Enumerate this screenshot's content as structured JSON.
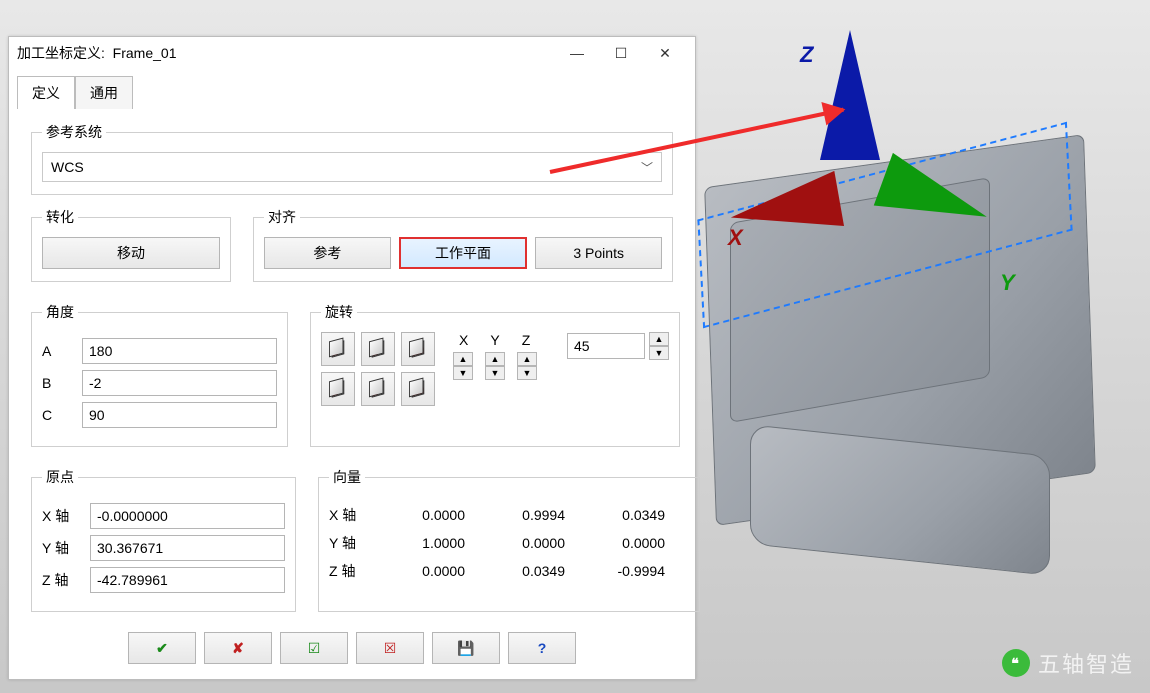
{
  "window": {
    "title_prefix": "加工坐标定义:",
    "title_name": "Frame_01"
  },
  "tabs": {
    "define": "定义",
    "general": "通用"
  },
  "ref_system": {
    "legend": "参考系统",
    "value": "WCS"
  },
  "transform": {
    "legend": "转化",
    "move": "移动"
  },
  "align": {
    "legend": "对齐",
    "ref": "参考",
    "workplane": "工作平面",
    "three_points": "3 Points"
  },
  "angle": {
    "legend": "角度",
    "A": {
      "label": "A",
      "value": "180"
    },
    "B": {
      "label": "B",
      "value": "-2"
    },
    "C": {
      "label": "C",
      "value": "90"
    }
  },
  "rotate": {
    "legend": "旋转",
    "xyz": {
      "x": "X",
      "y": "Y",
      "z": "Z"
    },
    "step": "45"
  },
  "origin": {
    "legend": "原点",
    "X": {
      "label": "X 轴",
      "value": "-0.0000000"
    },
    "Y": {
      "label": "Y 轴",
      "value": "30.367671"
    },
    "Z": {
      "label": "Z 轴",
      "value": "-42.789961"
    }
  },
  "vector": {
    "legend": "向量",
    "rows": [
      {
        "label": "X 轴",
        "v1": "0.0000",
        "v2": "0.9994",
        "v3": "0.0349"
      },
      {
        "label": "Y 轴",
        "v1": "1.0000",
        "v2": "0.0000",
        "v3": "0.0000"
      },
      {
        "label": "Z 轴",
        "v1": "0.0000",
        "v2": "0.0349",
        "v3": "-0.9994"
      }
    ]
  },
  "axes": {
    "x": "X",
    "y": "Y",
    "z": "Z"
  },
  "watermark": "五轴智造"
}
